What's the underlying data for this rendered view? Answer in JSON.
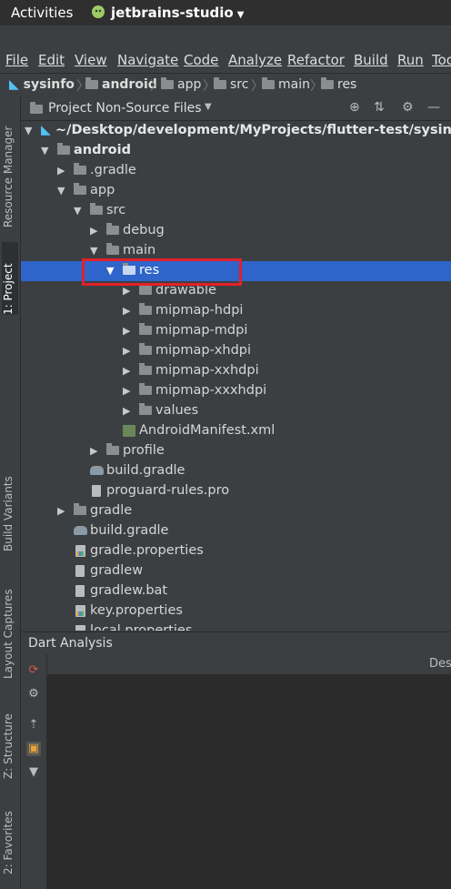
{
  "topbar": {
    "activities": "Activities",
    "app_name": "jetbrains-studio"
  },
  "menu": [
    "File",
    "Edit",
    "View",
    "Navigate",
    "Code",
    "Analyze",
    "Refactor",
    "Build",
    "Run",
    "Tools"
  ],
  "breadcrumb": [
    "sysinfo",
    "android",
    "app",
    "src",
    "main",
    "res"
  ],
  "left_tabs": {
    "resource_manager": "Resource Manager",
    "project": "1: Project",
    "build_variants": "Build Variants",
    "layout_captures": "Layout Captures",
    "structure": "Z: Structure",
    "favorites": "2: Favorites"
  },
  "project_panel": {
    "view_mode": "Project Non-Source Files",
    "tree": [
      {
        "label": "~/Desktop/development/MyProjects/flutter-test/sysinfo",
        "icon": "flutter-icon",
        "expanded": true
      },
      {
        "label": "android",
        "icon": "folder-icon",
        "expanded": true
      },
      {
        "label": ".gradle",
        "icon": "folder-icon",
        "expanded": false
      },
      {
        "label": "app",
        "icon": "folder-icon",
        "expanded": true
      },
      {
        "label": "src",
        "icon": "folder-icon",
        "expanded": true
      },
      {
        "label": "debug",
        "icon": "folder-icon",
        "expanded": false
      },
      {
        "label": "main",
        "icon": "folder-icon",
        "expanded": true
      },
      {
        "label": "res",
        "icon": "folder-icon",
        "expanded": true,
        "selected": true
      },
      {
        "label": "drawable",
        "icon": "folder-icon",
        "expanded": false
      },
      {
        "label": "mipmap-hdpi",
        "icon": "folder-icon",
        "expanded": false
      },
      {
        "label": "mipmap-mdpi",
        "icon": "folder-icon",
        "expanded": false
      },
      {
        "label": "mipmap-xhdpi",
        "icon": "folder-icon",
        "expanded": false
      },
      {
        "label": "mipmap-xxhdpi",
        "icon": "folder-icon",
        "expanded": false
      },
      {
        "label": "mipmap-xxxhdpi",
        "icon": "folder-icon",
        "expanded": false
      },
      {
        "label": "values",
        "icon": "folder-icon",
        "expanded": false
      },
      {
        "label": "AndroidManifest.xml",
        "icon": "manifest-icon"
      },
      {
        "label": "profile",
        "icon": "folder-icon",
        "expanded": false
      },
      {
        "label": "build.gradle",
        "icon": "gradle-icon"
      },
      {
        "label": "proguard-rules.pro",
        "icon": "file-icon"
      },
      {
        "label": "gradle",
        "icon": "folder-icon",
        "expanded": false
      },
      {
        "label": "build.gradle",
        "icon": "gradle-icon"
      },
      {
        "label": "gradle.properties",
        "icon": "properties-icon"
      },
      {
        "label": "gradlew",
        "icon": "file-icon"
      },
      {
        "label": "gradlew.bat",
        "icon": "file-icon"
      },
      {
        "label": "key.properties",
        "icon": "properties-icon"
      },
      {
        "label": "local.properties",
        "icon": "properties-icon"
      }
    ]
  },
  "dart_analysis": {
    "title": "Dart Analysis",
    "column_header": "Des"
  },
  "colors": {
    "selection": "#2f65ca",
    "highlight_box": "#e1202a",
    "background": "#3c3f41"
  }
}
